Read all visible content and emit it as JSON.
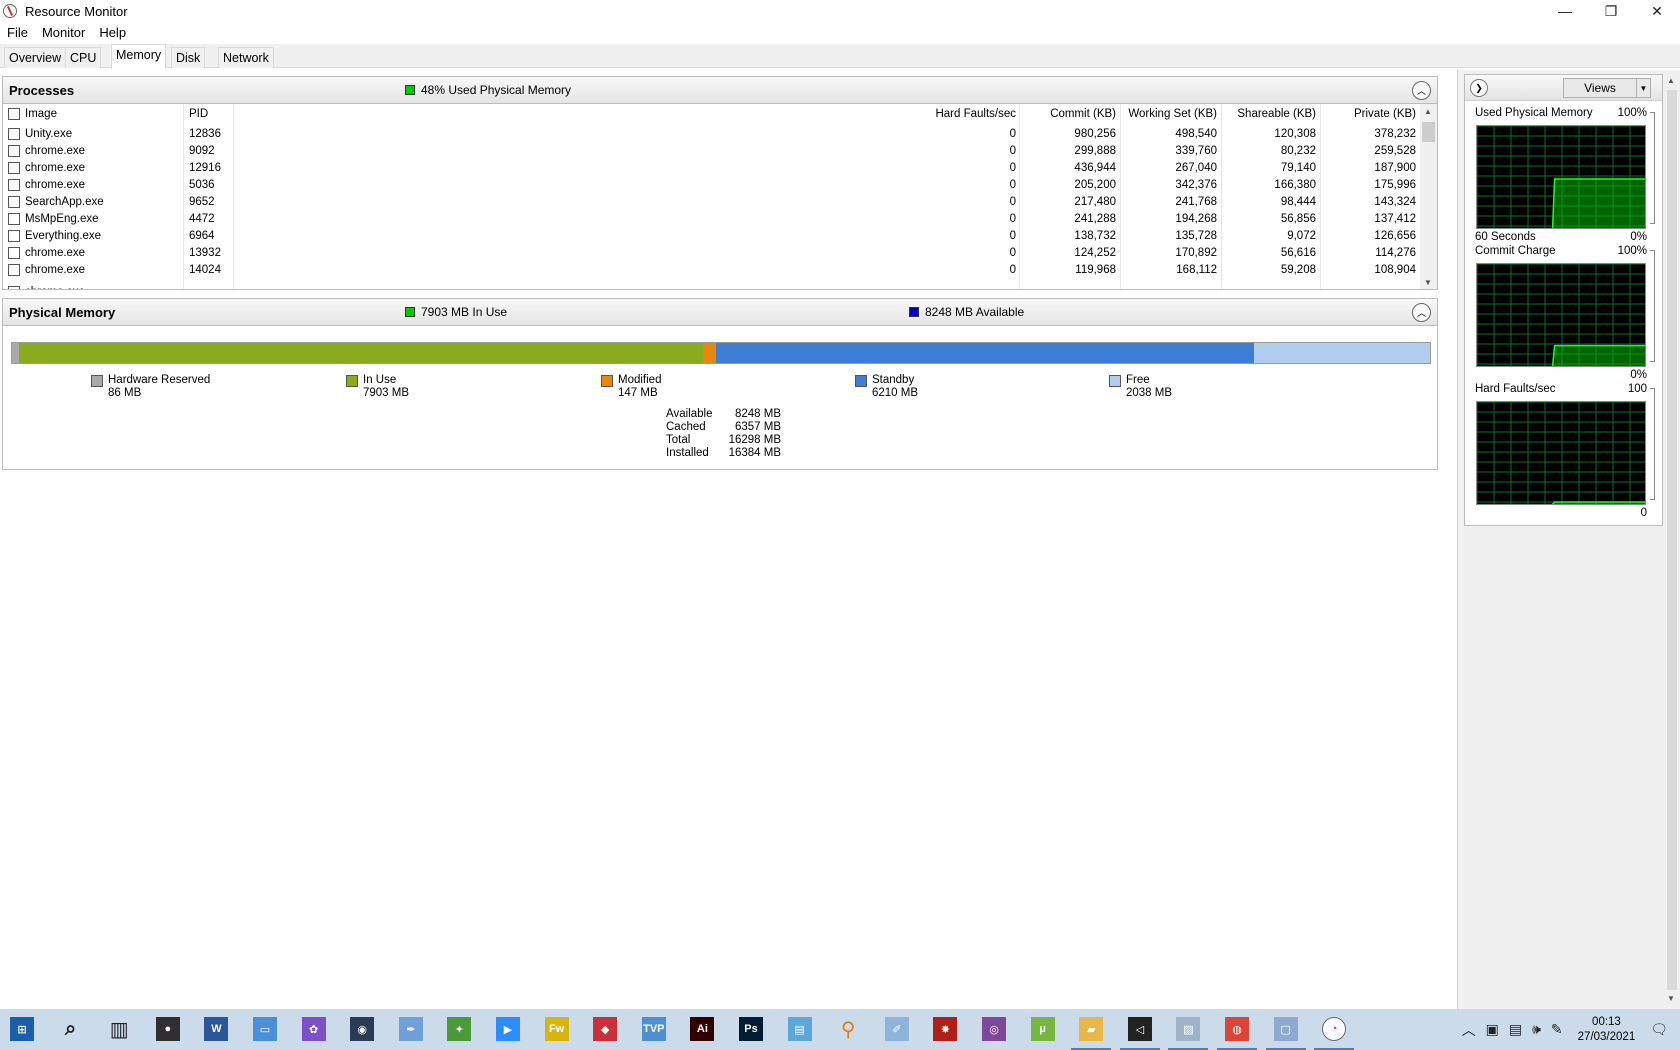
{
  "window": {
    "title": "Resource Monitor",
    "minimize": "—",
    "maximize": "❐",
    "close": "✕"
  },
  "menu": [
    "File",
    "Monitor",
    "Help"
  ],
  "tabs": [
    "Overview",
    "CPU",
    "Memory",
    "Disk",
    "Network"
  ],
  "active_tab": "Memory",
  "processes": {
    "title": "Processes",
    "stat": "48% Used Physical Memory",
    "stat_color": "#00cc00",
    "columns": [
      "Image",
      "PID",
      "Hard Faults/sec",
      "Commit (KB)",
      "Working Set (KB)",
      "Shareable (KB)",
      "Private (KB)"
    ],
    "rows": [
      {
        "image": "Unity.exe",
        "pid": "12836",
        "hf": "0",
        "commit": "980,256",
        "ws": "498,540",
        "share": "120,308",
        "private": "378,232"
      },
      {
        "image": "chrome.exe",
        "pid": "9092",
        "hf": "0",
        "commit": "299,888",
        "ws": "339,760",
        "share": "80,232",
        "private": "259,528"
      },
      {
        "image": "chrome.exe",
        "pid": "12916",
        "hf": "0",
        "commit": "436,944",
        "ws": "267,040",
        "share": "79,140",
        "private": "187,900"
      },
      {
        "image": "chrome.exe",
        "pid": "5036",
        "hf": "0",
        "commit": "205,200",
        "ws": "342,376",
        "share": "166,380",
        "private": "175,996"
      },
      {
        "image": "SearchApp.exe",
        "pid": "9652",
        "hf": "0",
        "commit": "217,480",
        "ws": "241,768",
        "share": "98,444",
        "private": "143,324"
      },
      {
        "image": "MsMpEng.exe",
        "pid": "4472",
        "hf": "0",
        "commit": "241,288",
        "ws": "194,268",
        "share": "56,856",
        "private": "137,412"
      },
      {
        "image": "Everything.exe",
        "pid": "6964",
        "hf": "0",
        "commit": "138,732",
        "ws": "135,728",
        "share": "9,072",
        "private": "126,656"
      },
      {
        "image": "chrome.exe",
        "pid": "13932",
        "hf": "0",
        "commit": "124,252",
        "ws": "170,892",
        "share": "56,616",
        "private": "114,276"
      },
      {
        "image": "chrome.exe",
        "pid": "14024",
        "hf": "0",
        "commit": "119,968",
        "ws": "168,112",
        "share": "59,208",
        "private": "108,904"
      }
    ]
  },
  "physical_memory": {
    "title": "Physical Memory",
    "in_use_stat": "7903 MB In Use",
    "available_stat": "8248 MB Available",
    "in_use_color": "#00cc00",
    "available_color": "#0000cc",
    "bar": [
      {
        "name": "Hardware Reserved",
        "value_mb": 86,
        "color": "#a9a9a9"
      },
      {
        "name": "In Use",
        "value_mb": 7903,
        "color": "#8aab1b"
      },
      {
        "name": "Modified",
        "value_mb": 147,
        "color": "#e8860e"
      },
      {
        "name": "Standby",
        "value_mb": 6210,
        "color": "#3f7fd3"
      },
      {
        "name": "Free",
        "value_mb": 2038,
        "color": "#b3cdee"
      }
    ],
    "legend": [
      {
        "name": "Hardware Reserved",
        "value": "86 MB",
        "color": "#a9a9a9"
      },
      {
        "name": "In Use",
        "value": "7903 MB",
        "color": "#8aab1b"
      },
      {
        "name": "Modified",
        "value": "147 MB",
        "color": "#e8860e"
      },
      {
        "name": "Standby",
        "value": "6210 MB",
        "color": "#3f7fd3"
      },
      {
        "name": "Free",
        "value": "2038 MB",
        "color": "#b3cdee"
      }
    ],
    "summary": [
      {
        "k": "Available",
        "v": "8248 MB"
      },
      {
        "k": "Cached",
        "v": "6357 MB"
      },
      {
        "k": "Total",
        "v": "16298 MB"
      },
      {
        "k": "Installed",
        "v": "16384 MB"
      }
    ]
  },
  "side": {
    "views_label": "Views",
    "graphs": [
      {
        "title": "Used Physical Memory",
        "max": "100%",
        "bottom_left": "60 Seconds",
        "bottom_right": "0%",
        "level": 0.48,
        "step_at": 0.45
      },
      {
        "title": "Commit Charge",
        "max": "100%",
        "bottom_left": "",
        "bottom_right": "0%",
        "level": 0.2,
        "step_at": 0.45
      },
      {
        "title": "Hard Faults/sec",
        "max": "100",
        "bottom_left": "",
        "bottom_right": "0",
        "level": 0.02,
        "step_at": 0.45
      }
    ]
  },
  "taskbar": {
    "clock_time": "00:13",
    "clock_date": "27/03/2021",
    "icons": [
      "start-icon",
      "search-icon",
      "task-view-icon",
      "obs-icon",
      "word-icon",
      "pc-icon",
      "krita-icon",
      "webcam-icon",
      "feather-icon",
      "plant-icon",
      "zoom-icon",
      "fireworks-icon",
      "git-icon",
      "tvpaint-icon",
      "illustrator-icon",
      "photoshop-icon",
      "notepad-icon",
      "search-tool-icon",
      "paint-icon",
      "crab-icon",
      "tor-icon",
      "utorrent-icon",
      "file-explorer-icon",
      "unity-icon",
      "image-viewer-icon",
      "chrome-icon",
      "app-window-icon",
      "resource-monitor-icon"
    ]
  }
}
